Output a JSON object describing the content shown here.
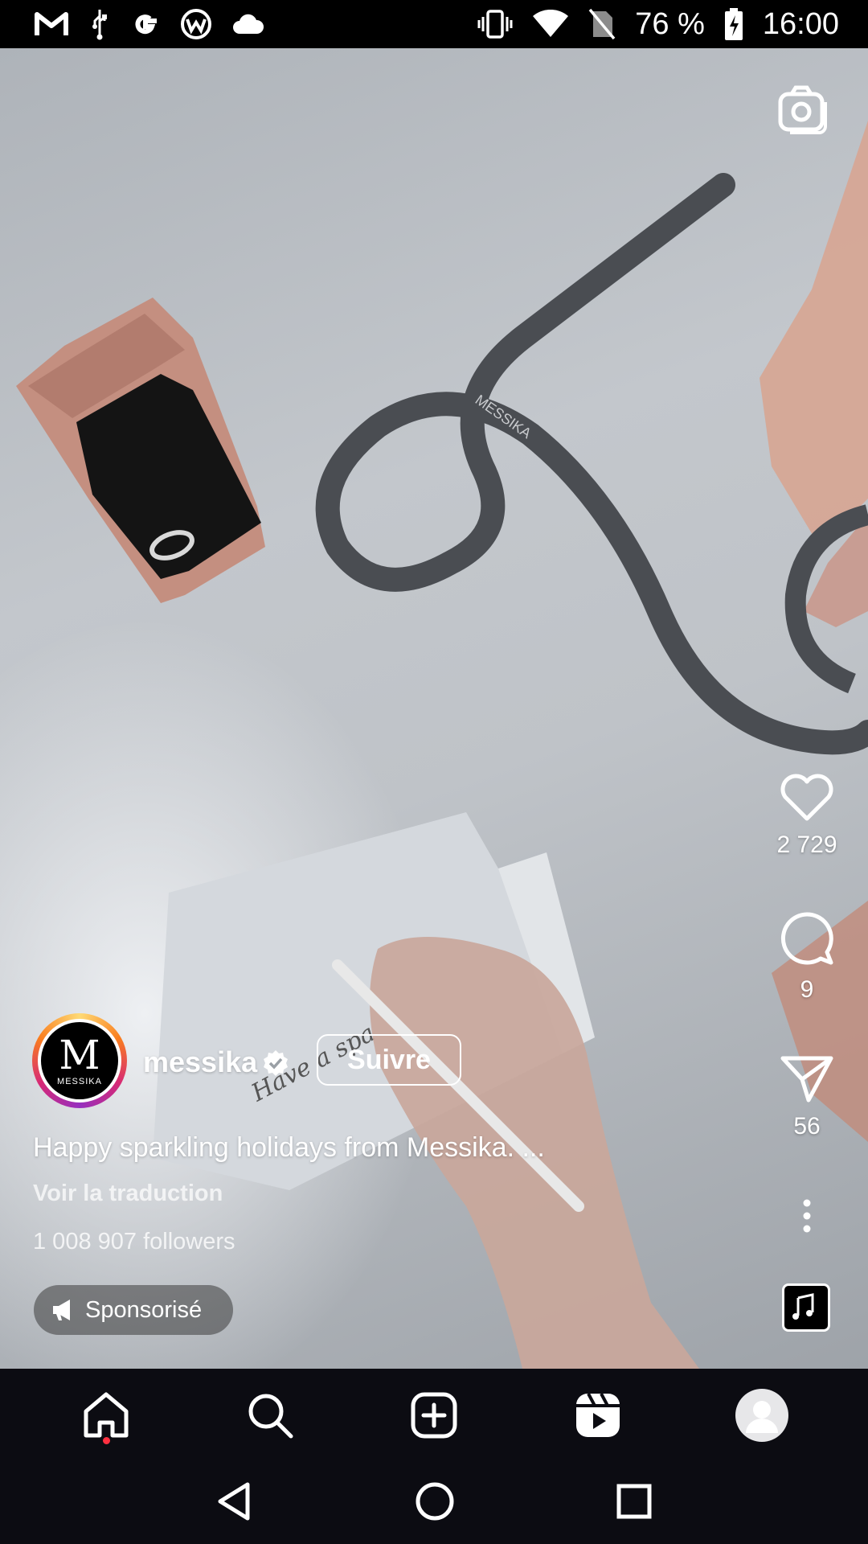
{
  "status_bar": {
    "battery": "76 %",
    "time": "16:00",
    "left_icons": [
      "gmail-icon",
      "usb-icon",
      "google-icon",
      "app-icon",
      "cloud-icon"
    ],
    "right_icons": [
      "vibrate-icon",
      "wifi-icon",
      "no-sim-icon",
      "battery-charging-icon"
    ]
  },
  "reel": {
    "account": {
      "username": "messika",
      "avatar_letter": "M",
      "avatar_text": "MESSIKA",
      "verified": true
    },
    "follow_label": "Suivre",
    "caption": "Happy sparkling holidays from Messika. ...",
    "translate_label": "Voir la traduction",
    "followers_text": "1 008 907 followers",
    "sponsored_label": "Sponsorisé",
    "likes": "2 729",
    "comments": "9",
    "shares": "56",
    "scene_text": {
      "ribbon_text": "MESSIKA",
      "card_text": "Have a spa"
    }
  },
  "bottom_nav": {
    "items": [
      "home-icon",
      "search-icon",
      "create-icon",
      "reels-icon",
      "profile-icon"
    ]
  },
  "colors": {
    "story_ring": [
      "#feda75",
      "#fa7e1e",
      "#d62976",
      "#962fbf"
    ],
    "notification_dot": "#ff3040",
    "nav_background": "#0c0c12"
  }
}
